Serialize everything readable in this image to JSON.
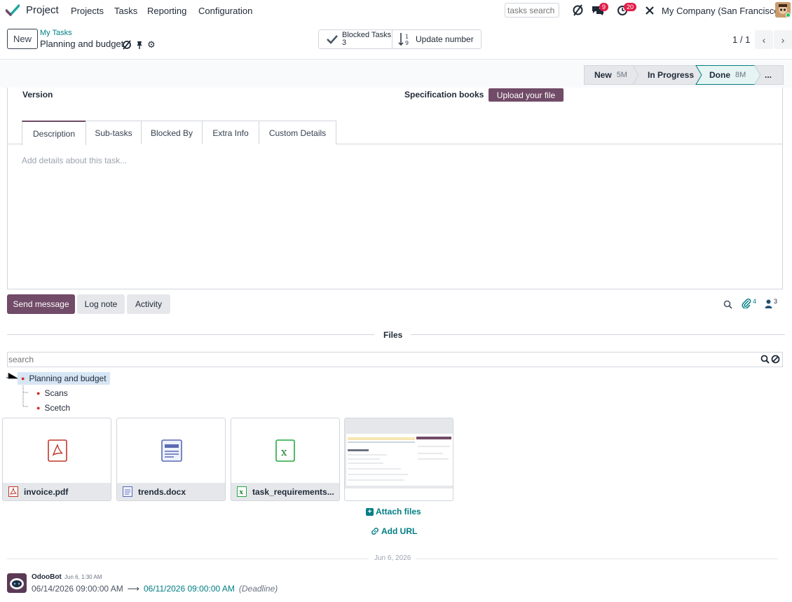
{
  "navbar": {
    "app_name": "Project",
    "menus": [
      "Projects",
      "Tasks",
      "Reporting",
      "Configuration"
    ],
    "search_placeholder": "tasks search",
    "messages_count": "9",
    "activities_count": "20",
    "company": "My Company (San Francisco)"
  },
  "control": {
    "new_label": "New",
    "breadcrumb_parent": "My Tasks",
    "breadcrumb_current": "Planning and budget",
    "blocked_tasks_label": "Blocked Tasks",
    "blocked_tasks_count": "3",
    "update_number_label": "Update number",
    "pager": "1 / 1"
  },
  "statusbar": {
    "stages": [
      {
        "name": "New",
        "duration": "5M"
      },
      {
        "name": "In Progress",
        "duration": ""
      },
      {
        "name": "Done",
        "duration": "8M"
      }
    ],
    "more": "..."
  },
  "form": {
    "version_label": "Version",
    "spec_label": "Specification books",
    "upload_label": "Upload your file",
    "tabs": [
      "Description",
      "Sub-tasks",
      "Blocked By",
      "Extra Info",
      "Custom Details"
    ],
    "description_placeholder": "Add details about this task..."
  },
  "chatter": {
    "send_message": "Send message",
    "log_note": "Log note",
    "activity": "Activity",
    "attachments_count": "4",
    "followers_count": "3"
  },
  "files": {
    "title": "Files",
    "search_placeholder": "search",
    "tree": [
      "Planning and budget",
      "Scans",
      "Scetch"
    ],
    "cards": [
      "invoice.pdf",
      "trends.docx",
      "task_requirements..."
    ],
    "attach_files": "Attach files",
    "add_url": "Add URL"
  },
  "messages": {
    "date": "Jun 6, 2026",
    "author": "OdooBot",
    "time": "Jun 6, 1:30 AM",
    "old_value": "06/14/2026 09:00:00 AM",
    "new_value": "06/11/2026 09:00:00 AM",
    "field": "(Deadline)"
  },
  "colors": {
    "brand": "#714b67",
    "link": "#017e84",
    "badge": "#e11d48"
  }
}
